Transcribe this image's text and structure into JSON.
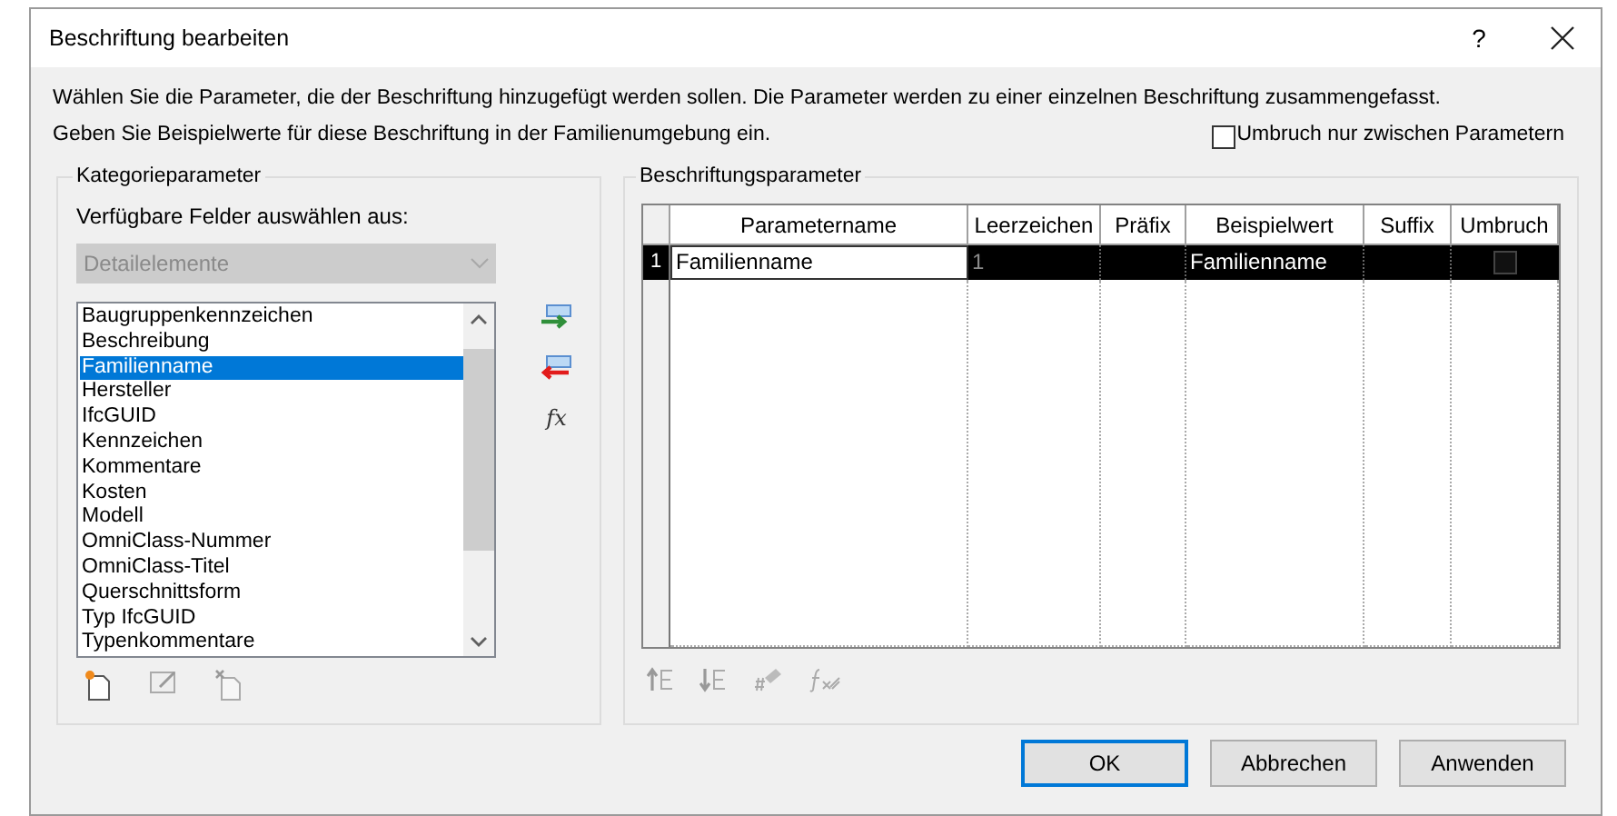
{
  "window": {
    "title": "Beschriftung bearbeiten",
    "help": "?"
  },
  "instructions": [
    "Wählen Sie die Parameter, die der Beschriftung hinzugefügt werden sollen. Die Parameter werden zu einer einzelnen Beschriftung zusammengefasst.",
    "Geben Sie Beispielwerte für diese Beschriftung in der Familienumgebung ein."
  ],
  "wrap_option": {
    "label": "Umbruch nur zwischen Parametern",
    "checked": false
  },
  "category_group": {
    "title": "Kategorieparameter",
    "label": "Verfügbare Felder auswählen aus:",
    "dropdown": {
      "value": "Detailelemente",
      "disabled": true
    },
    "fields": [
      {
        "label": "Baugruppenkennzeichen",
        "selected": false
      },
      {
        "label": "Beschreibung",
        "selected": false
      },
      {
        "label": "Familienname",
        "selected": true
      },
      {
        "label": "Hersteller",
        "selected": false
      },
      {
        "label": "IfcGUID",
        "selected": false
      },
      {
        "label": "Kennzeichen",
        "selected": false
      },
      {
        "label": "Kommentare",
        "selected": false
      },
      {
        "label": "Kosten",
        "selected": false
      },
      {
        "label": "Modell",
        "selected": false
      },
      {
        "label": "OmniClass-Nummer",
        "selected": false
      },
      {
        "label": "OmniClass-Titel",
        "selected": false
      },
      {
        "label": "Querschnittsform",
        "selected": false
      },
      {
        "label": "Typ IfcGUID",
        "selected": false
      },
      {
        "label": "Typenkommentare",
        "selected": false
      }
    ]
  },
  "formula_button": "fx",
  "label_group": {
    "title": "Beschriftungsparameter",
    "columns": [
      "Parametername",
      "Leerzeichen",
      "Präfix",
      "Beispielwert",
      "Suffix",
      "Umbruch"
    ],
    "rows": [
      {
        "number": "1",
        "parameter_name": "Familienname",
        "spaces": "1",
        "sample_value": "Familienname",
        "wrap": false,
        "selected": true
      }
    ]
  },
  "buttons": [
    {
      "label": "OK",
      "default": true
    },
    {
      "label": "Abbrechen",
      "default": false
    },
    {
      "label": "Anwenden",
      "default": false
    }
  ]
}
